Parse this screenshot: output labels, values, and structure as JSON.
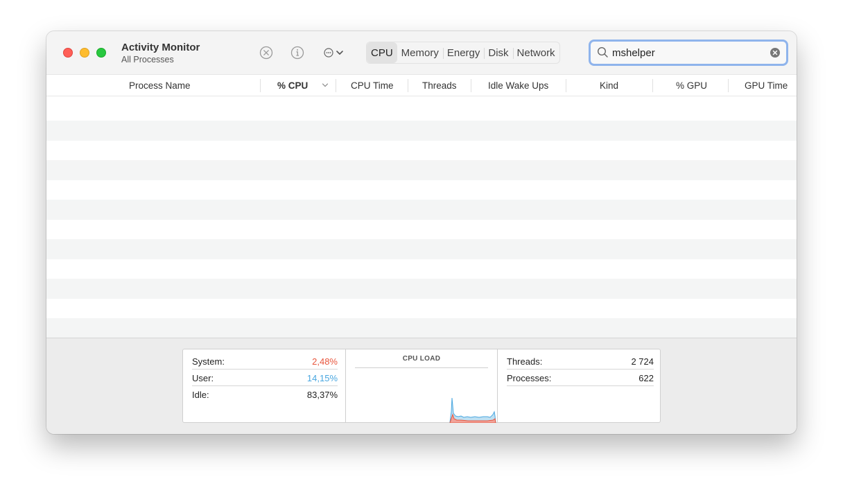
{
  "window": {
    "title": "Activity Monitor",
    "subtitle": "All Processes"
  },
  "toolbar": {
    "stop_icon": "stop-process-icon",
    "info_icon": "info-icon",
    "more_icon": "more-options-icon",
    "tabs": [
      {
        "label": "CPU",
        "active": true
      },
      {
        "label": "Memory",
        "active": false
      },
      {
        "label": "Energy",
        "active": false
      },
      {
        "label": "Disk",
        "active": false
      },
      {
        "label": "Network",
        "active": false
      }
    ]
  },
  "search": {
    "value": "mshelper",
    "placeholder": "Search",
    "accent_color": "#8fb4ec"
  },
  "table": {
    "columns": [
      "Process Name",
      "% CPU",
      "CPU Time",
      "Threads",
      "Idle Wake Ups",
      "Kind",
      "% GPU",
      "GPU Time"
    ],
    "sorted_column": "% CPU",
    "rows": []
  },
  "stats": {
    "system_label": "System:",
    "system_value": "2,48%",
    "system_color": "#e8553c",
    "user_label": "User:",
    "user_value": "14,15%",
    "user_color": "#4aa7e0",
    "idle_label": "Idle:",
    "idle_value": "83,37%",
    "cpu_load_title": "CPU LOAD",
    "threads_label": "Threads:",
    "threads_value": "2 724",
    "processes_label": "Processes:",
    "processes_value": "622"
  }
}
